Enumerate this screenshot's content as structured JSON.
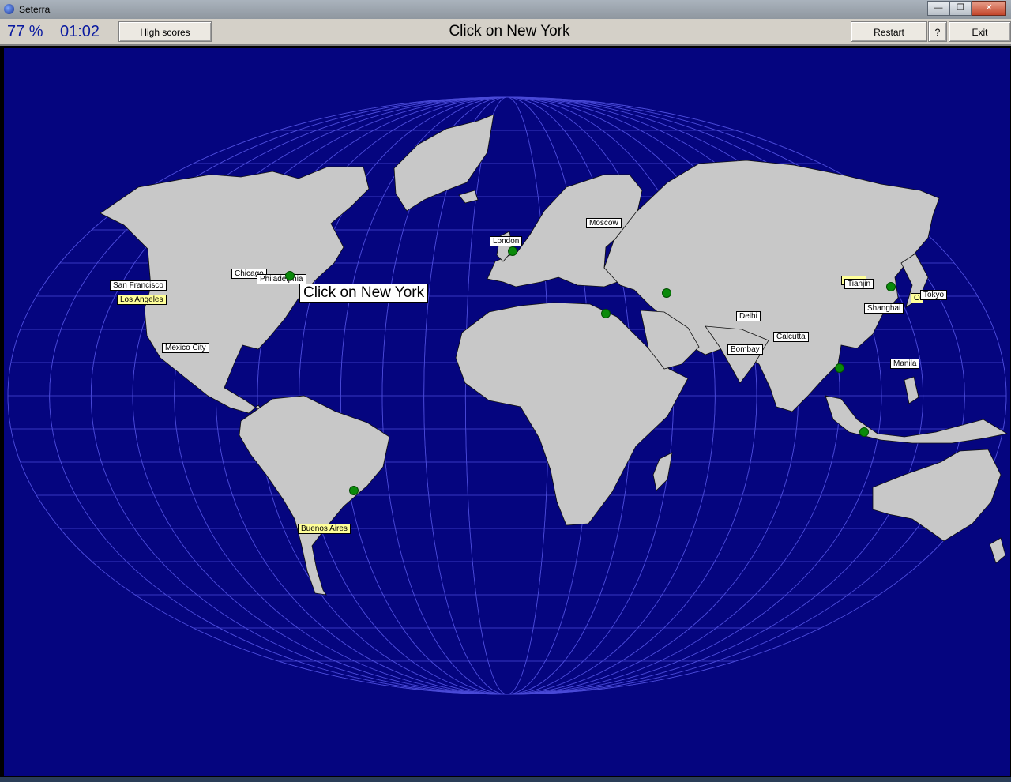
{
  "window": {
    "title": "Seterra"
  },
  "toolbar": {
    "score": "77 %",
    "timer": "01:02",
    "high_scores_label": "High scores",
    "prompt": "Click on New York",
    "restart_label": "Restart",
    "help_label": "?",
    "exit_label": "Exit"
  },
  "map": {
    "cursor_tooltip": "Click on New York",
    "labels": {
      "san_francisco": "San Francisco",
      "los_angeles": "Los Angeles",
      "chicago": "Chicago",
      "philadelphia": "Philadelphia",
      "mexico_city": "Mexico City",
      "buenos_aires": "Buenos Aires",
      "london": "London",
      "moscow": "Moscow",
      "delhi": "Delhi",
      "bombay": "Bombay",
      "calcutta": "Calcutta",
      "tianjin": "Tianjin",
      "shanghai": "Shanghai",
      "tokyo": "Tokyo",
      "osaka_partial": "O",
      "manila": "Manila"
    },
    "colors": {
      "ocean": "#05057f",
      "land": "#c8c8c8",
      "marker": "#0a8a0a",
      "highlight_label": "#ffff99"
    }
  }
}
